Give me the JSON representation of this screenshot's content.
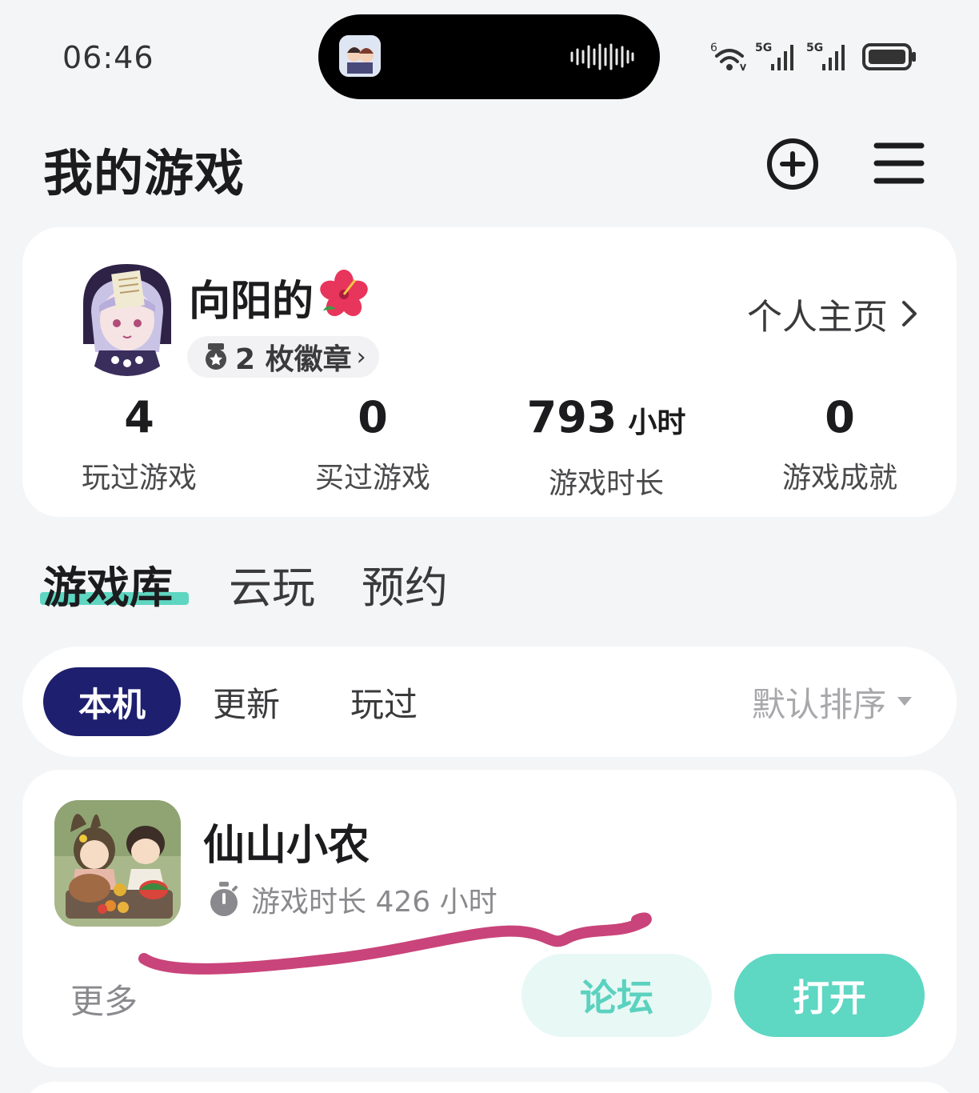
{
  "status_bar": {
    "time": "06:46",
    "network_1": "5G",
    "network_2": "5G",
    "wifi_label": "6"
  },
  "header": {
    "title": "我的游戏",
    "add_icon": "add-circle-icon",
    "menu_icon": "hamburger-menu-icon"
  },
  "profile": {
    "username": "向阳的",
    "username_emoji": "hibiscus-icon",
    "badges_label": "2 枚徽章",
    "homepage_label": "个人主页",
    "stats": [
      {
        "value": "4",
        "unit": "",
        "label": "玩过游戏"
      },
      {
        "value": "0",
        "unit": "",
        "label": "买过游戏"
      },
      {
        "value": "793",
        "unit": "小时",
        "label": "游戏时长"
      },
      {
        "value": "0",
        "unit": "",
        "label": "游戏成就"
      }
    ]
  },
  "library_tabs": [
    {
      "label": "游戏库",
      "active": true
    },
    {
      "label": "云玩",
      "active": false
    },
    {
      "label": "预约",
      "active": false
    }
  ],
  "filters": {
    "chips": [
      {
        "label": "本机",
        "active": true
      },
      {
        "label": "更新",
        "active": false
      },
      {
        "label": "玩过",
        "active": false
      }
    ],
    "sort_label": "默认排序"
  },
  "game": {
    "name": "仙山小农",
    "playtime": "游戏时长 426 小时",
    "more_label": "更多",
    "forum_label": "论坛",
    "open_label": "打开"
  },
  "colors": {
    "accent_teal": "#5ed7c3",
    "chip_active": "#1e1f6f",
    "annotation_stroke": "#c9447a"
  }
}
